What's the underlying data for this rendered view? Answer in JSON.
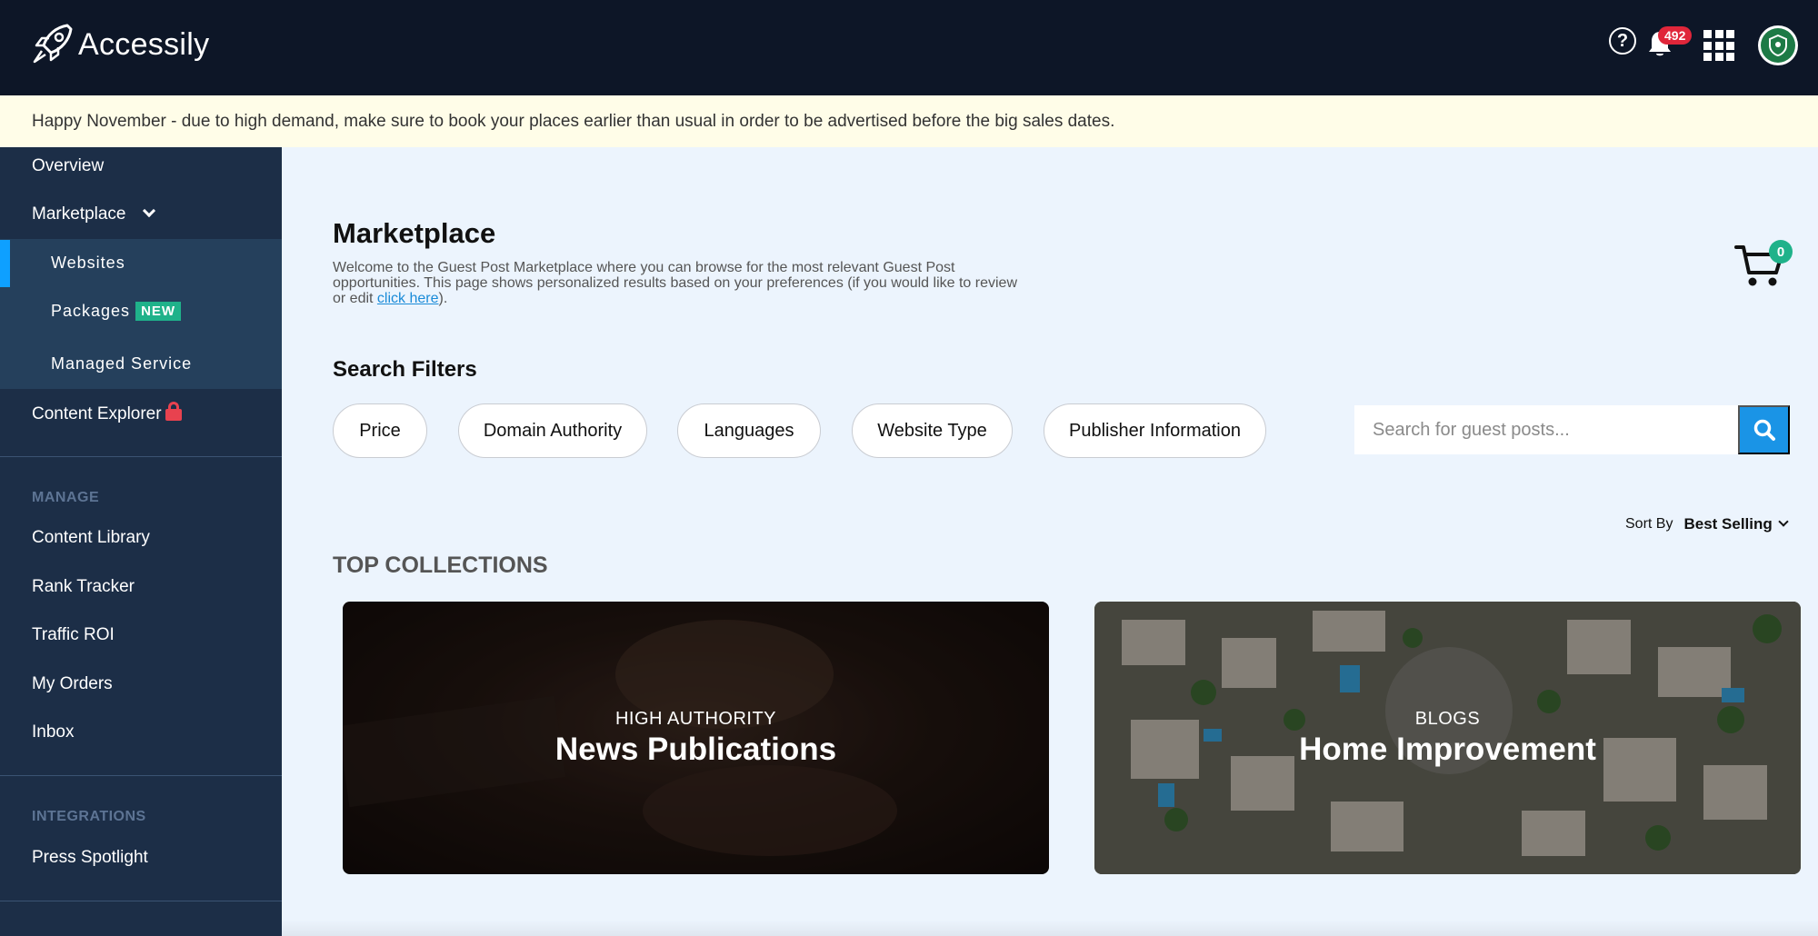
{
  "app": {
    "name": "Accessily"
  },
  "header": {
    "notifications_count": "492",
    "help_glyph": "?"
  },
  "notice": {
    "text": "Happy November - due to high demand, make sure to book your places earlier than usual in order to be advertised before the big sales dates."
  },
  "sidebar": {
    "overview": "Overview",
    "marketplace": "Marketplace",
    "sub_items": {
      "websites": "Websites",
      "packages": "Packages",
      "packages_badge": "NEW",
      "managed": "Managed Service"
    },
    "content_explorer": "Content Explorer",
    "manage_label": "MANAGE",
    "manage_items": {
      "content_library": "Content Library",
      "rank_tracker": "Rank Tracker",
      "traffic_roi": "Traffic ROI",
      "my_orders": "My Orders",
      "inbox": "Inbox"
    },
    "integrations_label": "INTEGRATIONS",
    "integrations_items": {
      "press_spotlight": "Press Spotlight"
    }
  },
  "main": {
    "title": "Marketplace",
    "description_prefix": "Welcome to the Guest Post Marketplace where you can browse for the most relevant Guest Post opportunities. This page shows personalized results based on your preferences (if you would like to review or edit ",
    "description_link": "click here",
    "description_suffix": ").",
    "cart_count": "0",
    "filters_title": "Search Filters",
    "filters": {
      "price": "Price",
      "domain_authority": "Domain Authority",
      "languages": "Languages",
      "website_type": "Website Type",
      "publisher_information": "Publisher Information"
    },
    "search_placeholder": "Search for guest posts...",
    "sort_label": "Sort By",
    "sort_value": "Best Selling",
    "collections_title": "TOP COLLECTIONS",
    "collections": {
      "news": {
        "sub": "HIGH AUTHORITY",
        "title": "News Publications"
      },
      "home": {
        "sub": "BLOGS",
        "title": "Home Improvement"
      }
    }
  },
  "colors": {
    "header_bg": "#0d1627",
    "sidebar_bg": "#1c2e47",
    "accent": "#1a94e6",
    "badge_green": "#1fb28a",
    "alert_red": "#e0263a"
  }
}
